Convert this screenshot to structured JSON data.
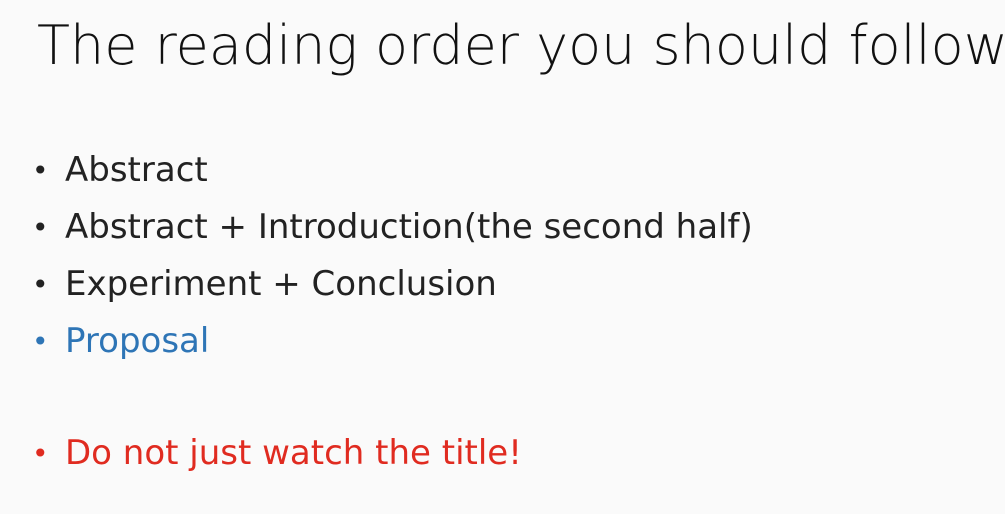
{
  "slide": {
    "title": "The reading order you should follow",
    "bullets": [
      {
        "text": "Abstract",
        "color": "#222222"
      },
      {
        "text": "Abstract + Introduction(the second half)",
        "color": "#222222"
      },
      {
        "text": "Experiment + Conclusion",
        "color": "#222222"
      },
      {
        "text": "Proposal",
        "color": "#2e75b6"
      },
      {
        "text": "Do not just watch the title!",
        "color": "#e02b20"
      }
    ],
    "bullet_glyph": "•"
  }
}
